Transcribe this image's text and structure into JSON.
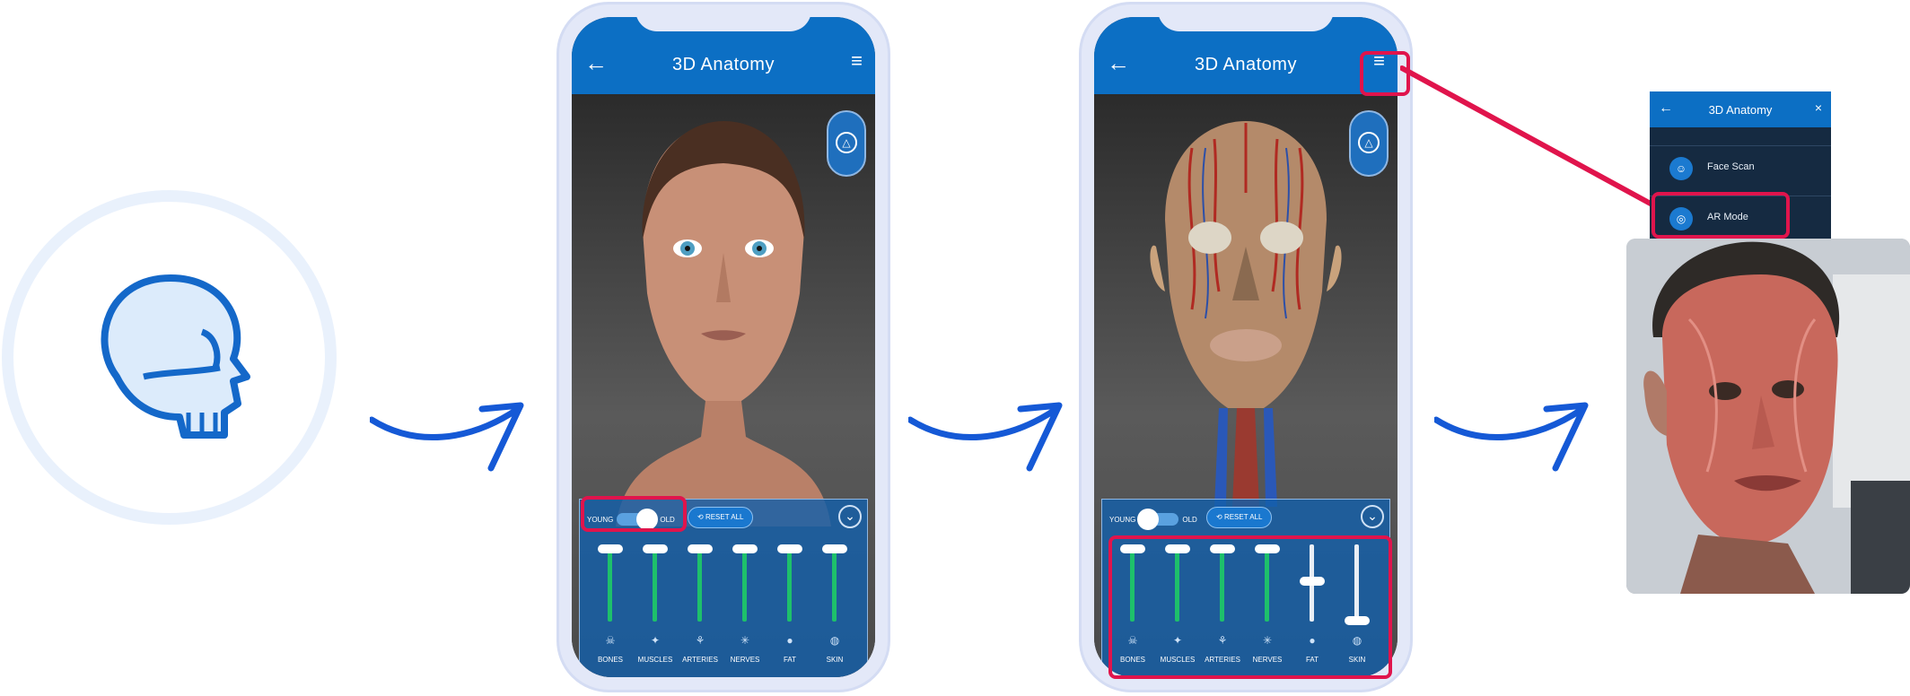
{
  "phone1": {
    "title": "3D Anatomy",
    "back_icon": "←",
    "menu_icon": "≡",
    "toggle_young": "YOUNG",
    "toggle_old": "OLD",
    "reset_label": "RESET ALL",
    "sliders": [
      {
        "label": "BONES",
        "icon": "skull-icon",
        "level": 1.0
      },
      {
        "label": "MUSCLES",
        "icon": "muscle-icon",
        "level": 1.0
      },
      {
        "label": "ARTERIES",
        "icon": "artery-icon",
        "level": 1.0
      },
      {
        "label": "NERVES",
        "icon": "nerve-icon",
        "level": 1.0
      },
      {
        "label": "FAT",
        "icon": "fat-icon",
        "level": 1.0
      },
      {
        "label": "SKIN",
        "icon": "skin-icon",
        "level": 1.0
      }
    ]
  },
  "phone2": {
    "title": "3D Anatomy",
    "back_icon": "←",
    "menu_icon": "≡",
    "toggle_young": "YOUNG",
    "toggle_old": "OLD",
    "reset_label": "RESET ALL",
    "sliders": [
      {
        "label": "BONES",
        "icon": "skull-icon",
        "level": 1.0
      },
      {
        "label": "MUSCLES",
        "icon": "muscle-icon",
        "level": 1.0
      },
      {
        "label": "ARTERIES",
        "icon": "artery-icon",
        "level": 1.0
      },
      {
        "label": "NERVES",
        "icon": "nerve-icon",
        "level": 1.0
      },
      {
        "label": "FAT",
        "icon": "fat-icon",
        "level": 0.55
      },
      {
        "label": "SKIN",
        "icon": "skin-icon",
        "level": 0.0
      }
    ]
  },
  "menu_panel": {
    "title": "3D Anatomy",
    "back_icon": "←",
    "close_icon": "×",
    "items": [
      {
        "label": "Face Scan",
        "icon": "face-scan-icon"
      },
      {
        "label": "AR Mode",
        "icon": "ar-mode-icon"
      }
    ]
  },
  "colors": {
    "brand_blue": "#0c6fc4",
    "highlight": "#e0144c",
    "slider_on": "#1ec06b"
  }
}
